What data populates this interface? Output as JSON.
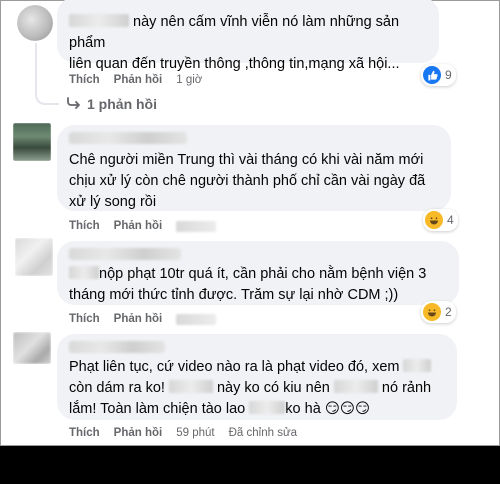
{
  "actions": {
    "like": "Thích",
    "reply": "Phản hồi",
    "edited": "Đã chỉnh sửa"
  },
  "comments": [
    {
      "text_a": "này nên cấm vĩnh viễn nó làm những sản phẩm",
      "text_b": "liên quan đến truyền thông ,thông tin,mạng xã hội...",
      "time": "1 giờ",
      "reaction": "like",
      "reaction_count": "9",
      "replies": "1 phản hồi"
    },
    {
      "text": "Chê người miền Trung thì vài tháng có khi vài năm mới chịu xử lý còn chê người thành phố chỉ cần vài ngày đã xử lý song rồi",
      "reaction": "haha",
      "reaction_count": "4"
    },
    {
      "text_a": "nộp phạt 10tr quá ít, cần phải cho nằm bệnh viện 3",
      "text_b": "tháng mới thức tỉnh được. Trăm sự lại nhờ CDM ;))",
      "reaction": "haha",
      "reaction_count": "2"
    },
    {
      "text_1": "Phạt liên tục, cứ video nào ra là phạt video đó, xem",
      "text_2a": "còn dám ra ko!",
      "text_2b": "này ko có kiu nên",
      "text_2c": "nó rảnh",
      "text_3a": "lắm! Toàn làm chiện tào lao",
      "text_3b": "ko hà",
      "emoji": "😏😏😏",
      "time": "59 phút"
    }
  ],
  "colors": {
    "like": "#1877f2",
    "haha": "#f7b928",
    "bubble": "#f0f2f5",
    "meta": "#65676b"
  },
  "icons": [
    "reply-arrow-icon",
    "like-icon",
    "haha-icon"
  ]
}
